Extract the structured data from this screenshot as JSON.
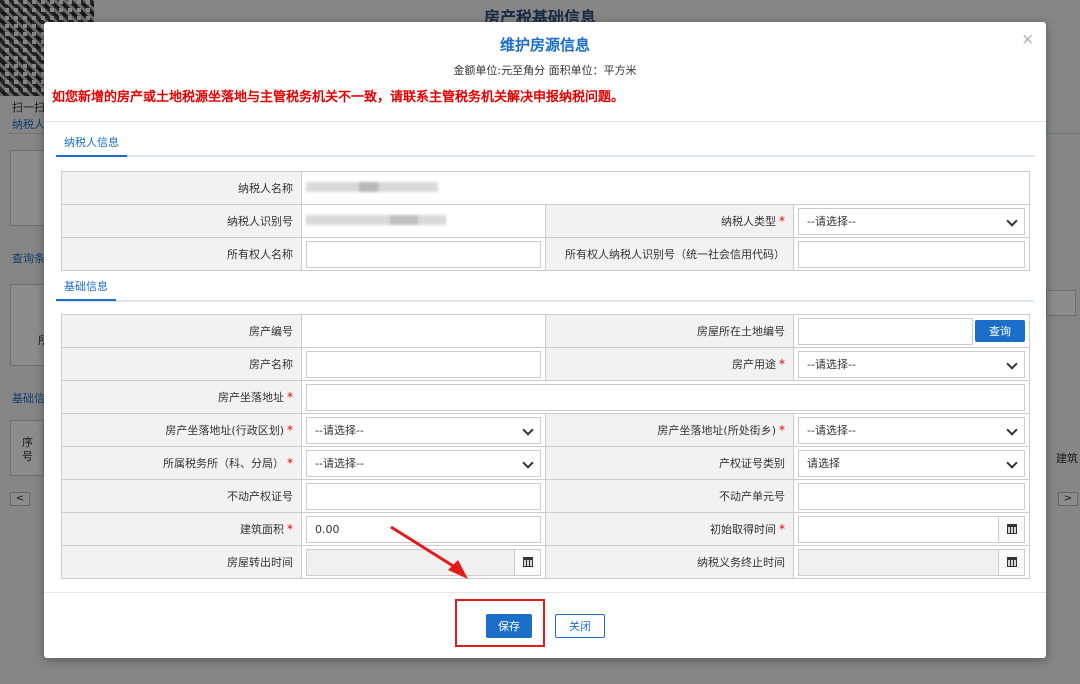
{
  "background": {
    "page_title": "房产税基础信息",
    "scan_text": "扫一扫",
    "tab_taxpayer": "纳税人",
    "tab_query": "查询条",
    "tab_basic": "基础信",
    "col_seq": "序号",
    "col_right": "建筑",
    "text_suo": "所",
    "left_arrow": "<",
    "right_arrow": ">"
  },
  "modal": {
    "title": "维护房源信息",
    "units": "金额单位:元至角分 面积单位：平方米",
    "warning": "如您新增的房产或土地税源坐落地与主管税务机关不一致，请联系主管税务机关解决申报纳税问题。",
    "close_glyph": "×"
  },
  "taxpayer_section": {
    "tab": "纳税人信息",
    "name_label": "纳税人名称",
    "id_label": "纳税人识别号",
    "type_label": "纳税人类型",
    "type_value": "--请选择--",
    "owner_name_label": "所有权人名称",
    "owner_name_value": "",
    "owner_id_label": "所有权人纳税人识别号（统一社会信用代码）",
    "owner_id_value": ""
  },
  "basic_section": {
    "tab": "基础信息",
    "house_no_label": "房产编号",
    "land_no_label": "房屋所在土地编号",
    "land_no_value": "",
    "query_button": "查询",
    "house_name_label": "房产名称",
    "house_name_value": "",
    "usage_label": "房产用途",
    "usage_value": "--请选择--",
    "address_label": "房产坐落地址",
    "address_value": "",
    "district_label": "房产坐落地址(行政区划)",
    "district_value": "--请选择--",
    "street_label": "房产坐落地址(所处街乡)",
    "street_value": "--请选择--",
    "tax_office_label": "所属税务所（科、分局）",
    "tax_office_value": "--请选择--",
    "cert_type_label": "产权证号类别",
    "cert_type_value": "请选择",
    "property_cert_label": "不动产权证号",
    "property_cert_value": "",
    "unit_no_label": "不动产单元号",
    "unit_no_value": "",
    "area_label": "建筑面积",
    "area_value": "0.00",
    "acquire_time_label": "初始取得时间",
    "acquire_time_value": "",
    "transfer_time_label": "房屋转出时间",
    "transfer_time_value": "",
    "end_time_label": "纳税义务终止时间",
    "end_time_value": ""
  },
  "footer": {
    "save": "保存",
    "close": "关闭"
  },
  "colors": {
    "accent": "#1c6fc9",
    "warning": "#e60000",
    "annotation": "#e31b1b"
  }
}
